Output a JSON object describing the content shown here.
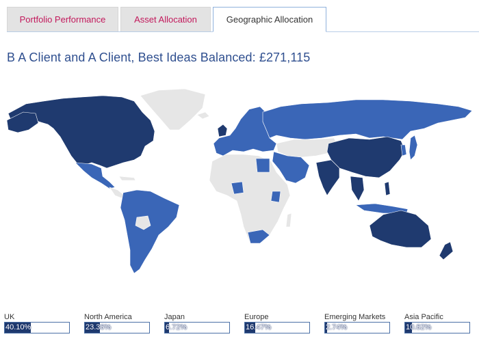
{
  "tabs": [
    {
      "label": "Portfolio Performance",
      "active": false
    },
    {
      "label": "Asset Allocation",
      "active": false
    },
    {
      "label": "Geographic Allocation",
      "active": true
    }
  ],
  "title": "B A Client and A Client, Best Ideas Balanced: £271,115",
  "colors": {
    "accent_text": "#c2185b",
    "title": "#2f4f8f",
    "invested_dark": "#1f3a6f",
    "invested_medium": "#3a66b7",
    "not_invested": "#e6e6e6"
  },
  "map": {
    "dark_regions": [
      "North America",
      "UK",
      "China",
      "India",
      "Southeast Asia",
      "Australia",
      "New Zealand"
    ],
    "medium_regions": [
      "Europe",
      "Russia",
      "Japan",
      "Korea",
      "South America",
      "Mexico",
      "Egypt",
      "Nigeria",
      "Kenya",
      "South Africa",
      "Middle East",
      "Indonesia"
    ]
  },
  "legend": [
    {
      "name": "UK",
      "value": "40.10%",
      "fraction": 0.401
    },
    {
      "name": "North America",
      "value": "23.36%",
      "fraction": 0.2336
    },
    {
      "name": "Japan",
      "value": "6.72%",
      "fraction": 0.0672
    },
    {
      "name": "Europe",
      "value": "16.47%",
      "fraction": 0.1647
    },
    {
      "name": "Emerging Markets",
      "value": "2.74%",
      "fraction": 0.0274
    },
    {
      "name": "Asia Pacific",
      "value": "10.62%",
      "fraction": 0.1062
    }
  ]
}
